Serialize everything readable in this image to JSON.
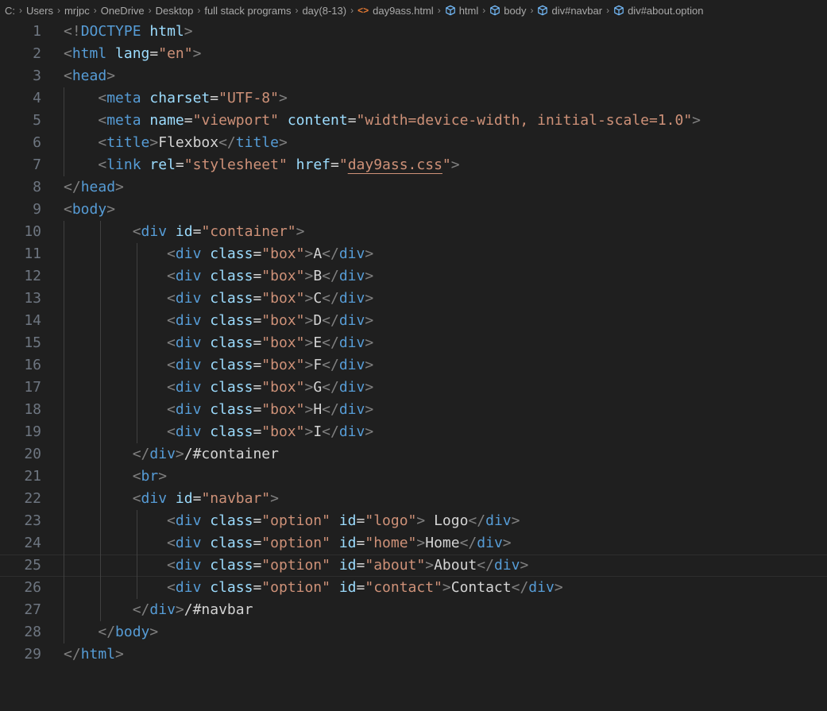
{
  "breadcrumbs": {
    "path": [
      "C:",
      "Users",
      "mrjpc",
      "OneDrive",
      "Desktop",
      "full stack programs",
      "day(8-13)"
    ],
    "file": "day9ass.html",
    "symbols": [
      "html",
      "body",
      "div#navbar",
      "div#about.option"
    ]
  },
  "editor": {
    "language": "html",
    "current_line": 25,
    "lines": [
      {
        "n": 1,
        "indent": 0,
        "tokens": [
          [
            "p",
            "<!"
          ],
          [
            "t",
            "DOCTYPE"
          ],
          [
            "x",
            " "
          ],
          [
            "a",
            "html"
          ],
          [
            "p",
            ">"
          ]
        ]
      },
      {
        "n": 2,
        "indent": 0,
        "tokens": [
          [
            "p",
            "<"
          ],
          [
            "t",
            "html"
          ],
          [
            "x",
            " "
          ],
          [
            "a",
            "lang"
          ],
          [
            "x",
            "="
          ],
          [
            "s",
            "\"en\""
          ],
          [
            "p",
            ">"
          ]
        ]
      },
      {
        "n": 3,
        "indent": 0,
        "tokens": [
          [
            "p",
            "<"
          ],
          [
            "t",
            "head"
          ],
          [
            "p",
            ">"
          ]
        ]
      },
      {
        "n": 4,
        "indent": 4,
        "tokens": [
          [
            "p",
            "<"
          ],
          [
            "t",
            "meta"
          ],
          [
            "x",
            " "
          ],
          [
            "a",
            "charset"
          ],
          [
            "x",
            "="
          ],
          [
            "s",
            "\"UTF-8\""
          ],
          [
            "p",
            ">"
          ]
        ]
      },
      {
        "n": 5,
        "indent": 4,
        "tokens": [
          [
            "p",
            "<"
          ],
          [
            "t",
            "meta"
          ],
          [
            "x",
            " "
          ],
          [
            "a",
            "name"
          ],
          [
            "x",
            "="
          ],
          [
            "s",
            "\"viewport\""
          ],
          [
            "x",
            " "
          ],
          [
            "a",
            "content"
          ],
          [
            "x",
            "="
          ],
          [
            "s",
            "\"width=device-width, initial-scale=1.0\""
          ],
          [
            "p",
            ">"
          ]
        ]
      },
      {
        "n": 6,
        "indent": 4,
        "tokens": [
          [
            "p",
            "<"
          ],
          [
            "t",
            "title"
          ],
          [
            "p",
            ">"
          ],
          [
            "x",
            "Flexbox"
          ],
          [
            "p",
            "</"
          ],
          [
            "t",
            "title"
          ],
          [
            "p",
            ">"
          ]
        ]
      },
      {
        "n": 7,
        "indent": 4,
        "tokens": [
          [
            "p",
            "<"
          ],
          [
            "t",
            "link"
          ],
          [
            "x",
            " "
          ],
          [
            "a",
            "rel"
          ],
          [
            "x",
            "="
          ],
          [
            "s",
            "\"stylesheet\""
          ],
          [
            "x",
            " "
          ],
          [
            "a",
            "href"
          ],
          [
            "x",
            "="
          ],
          [
            "s",
            "\""
          ],
          [
            "l",
            "day9ass.css"
          ],
          [
            "s",
            "\""
          ],
          [
            "p",
            ">"
          ]
        ]
      },
      {
        "n": 8,
        "indent": 0,
        "tokens": [
          [
            "p",
            "</"
          ],
          [
            "t",
            "head"
          ],
          [
            "p",
            ">"
          ]
        ]
      },
      {
        "n": 9,
        "indent": 0,
        "tokens": [
          [
            "p",
            "<"
          ],
          [
            "t",
            "body"
          ],
          [
            "p",
            ">"
          ]
        ]
      },
      {
        "n": 10,
        "indent": 8,
        "tokens": [
          [
            "p",
            "<"
          ],
          [
            "t",
            "div"
          ],
          [
            "x",
            " "
          ],
          [
            "a",
            "id"
          ],
          [
            "x",
            "="
          ],
          [
            "s",
            "\"container\""
          ],
          [
            "p",
            ">"
          ]
        ]
      },
      {
        "n": 11,
        "indent": 12,
        "tokens": [
          [
            "p",
            "<"
          ],
          [
            "t",
            "div"
          ],
          [
            "x",
            " "
          ],
          [
            "a",
            "class"
          ],
          [
            "x",
            "="
          ],
          [
            "s",
            "\"box\""
          ],
          [
            "p",
            ">"
          ],
          [
            "x",
            "A"
          ],
          [
            "p",
            "</"
          ],
          [
            "t",
            "div"
          ],
          [
            "p",
            ">"
          ]
        ]
      },
      {
        "n": 12,
        "indent": 12,
        "tokens": [
          [
            "p",
            "<"
          ],
          [
            "t",
            "div"
          ],
          [
            "x",
            " "
          ],
          [
            "a",
            "class"
          ],
          [
            "x",
            "="
          ],
          [
            "s",
            "\"box\""
          ],
          [
            "p",
            ">"
          ],
          [
            "x",
            "B"
          ],
          [
            "p",
            "</"
          ],
          [
            "t",
            "div"
          ],
          [
            "p",
            ">"
          ]
        ]
      },
      {
        "n": 13,
        "indent": 12,
        "tokens": [
          [
            "p",
            "<"
          ],
          [
            "t",
            "div"
          ],
          [
            "x",
            " "
          ],
          [
            "a",
            "class"
          ],
          [
            "x",
            "="
          ],
          [
            "s",
            "\"box\""
          ],
          [
            "p",
            ">"
          ],
          [
            "x",
            "C"
          ],
          [
            "p",
            "</"
          ],
          [
            "t",
            "div"
          ],
          [
            "p",
            ">"
          ]
        ]
      },
      {
        "n": 14,
        "indent": 12,
        "tokens": [
          [
            "p",
            "<"
          ],
          [
            "t",
            "div"
          ],
          [
            "x",
            " "
          ],
          [
            "a",
            "class"
          ],
          [
            "x",
            "="
          ],
          [
            "s",
            "\"box\""
          ],
          [
            "p",
            ">"
          ],
          [
            "x",
            "D"
          ],
          [
            "p",
            "</"
          ],
          [
            "t",
            "div"
          ],
          [
            "p",
            ">"
          ]
        ]
      },
      {
        "n": 15,
        "indent": 12,
        "tokens": [
          [
            "p",
            "<"
          ],
          [
            "t",
            "div"
          ],
          [
            "x",
            " "
          ],
          [
            "a",
            "class"
          ],
          [
            "x",
            "="
          ],
          [
            "s",
            "\"box\""
          ],
          [
            "p",
            ">"
          ],
          [
            "x",
            "E"
          ],
          [
            "p",
            "</"
          ],
          [
            "t",
            "div"
          ],
          [
            "p",
            ">"
          ]
        ]
      },
      {
        "n": 16,
        "indent": 12,
        "tokens": [
          [
            "p",
            "<"
          ],
          [
            "t",
            "div"
          ],
          [
            "x",
            " "
          ],
          [
            "a",
            "class"
          ],
          [
            "x",
            "="
          ],
          [
            "s",
            "\"box\""
          ],
          [
            "p",
            ">"
          ],
          [
            "x",
            "F"
          ],
          [
            "p",
            "</"
          ],
          [
            "t",
            "div"
          ],
          [
            "p",
            ">"
          ]
        ]
      },
      {
        "n": 17,
        "indent": 12,
        "tokens": [
          [
            "p",
            "<"
          ],
          [
            "t",
            "div"
          ],
          [
            "x",
            " "
          ],
          [
            "a",
            "class"
          ],
          [
            "x",
            "="
          ],
          [
            "s",
            "\"box\""
          ],
          [
            "p",
            ">"
          ],
          [
            "x",
            "G"
          ],
          [
            "p",
            "</"
          ],
          [
            "t",
            "div"
          ],
          [
            "p",
            ">"
          ]
        ]
      },
      {
        "n": 18,
        "indent": 12,
        "tokens": [
          [
            "p",
            "<"
          ],
          [
            "t",
            "div"
          ],
          [
            "x",
            " "
          ],
          [
            "a",
            "class"
          ],
          [
            "x",
            "="
          ],
          [
            "s",
            "\"box\""
          ],
          [
            "p",
            ">"
          ],
          [
            "x",
            "H"
          ],
          [
            "p",
            "</"
          ],
          [
            "t",
            "div"
          ],
          [
            "p",
            ">"
          ]
        ]
      },
      {
        "n": 19,
        "indent": 12,
        "tokens": [
          [
            "p",
            "<"
          ],
          [
            "t",
            "div"
          ],
          [
            "x",
            " "
          ],
          [
            "a",
            "class"
          ],
          [
            "x",
            "="
          ],
          [
            "s",
            "\"box\""
          ],
          [
            "p",
            ">"
          ],
          [
            "x",
            "I"
          ],
          [
            "p",
            "</"
          ],
          [
            "t",
            "div"
          ],
          [
            "p",
            ">"
          ]
        ]
      },
      {
        "n": 20,
        "indent": 8,
        "tokens": [
          [
            "p",
            "</"
          ],
          [
            "t",
            "div"
          ],
          [
            "p",
            ">"
          ],
          [
            "c",
            "/#container"
          ]
        ]
      },
      {
        "n": 21,
        "indent": 8,
        "tokens": [
          [
            "p",
            "<"
          ],
          [
            "t",
            "br"
          ],
          [
            "p",
            ">"
          ]
        ]
      },
      {
        "n": 22,
        "indent": 8,
        "tokens": [
          [
            "p",
            "<"
          ],
          [
            "t",
            "div"
          ],
          [
            "x",
            " "
          ],
          [
            "a",
            "id"
          ],
          [
            "x",
            "="
          ],
          [
            "s",
            "\"navbar\""
          ],
          [
            "p",
            ">"
          ]
        ]
      },
      {
        "n": 23,
        "indent": 12,
        "tokens": [
          [
            "p",
            "<"
          ],
          [
            "t",
            "div"
          ],
          [
            "x",
            " "
          ],
          [
            "a",
            "class"
          ],
          [
            "x",
            "="
          ],
          [
            "s",
            "\"option\""
          ],
          [
            "x",
            " "
          ],
          [
            "a",
            "id"
          ],
          [
            "x",
            "="
          ],
          [
            "s",
            "\"logo\""
          ],
          [
            "p",
            ">"
          ],
          [
            "x",
            " Logo"
          ],
          [
            "p",
            "</"
          ],
          [
            "t",
            "div"
          ],
          [
            "p",
            ">"
          ]
        ]
      },
      {
        "n": 24,
        "indent": 12,
        "tokens": [
          [
            "p",
            "<"
          ],
          [
            "t",
            "div"
          ],
          [
            "x",
            " "
          ],
          [
            "a",
            "class"
          ],
          [
            "x",
            "="
          ],
          [
            "s",
            "\"option\""
          ],
          [
            "x",
            " "
          ],
          [
            "a",
            "id"
          ],
          [
            "x",
            "="
          ],
          [
            "s",
            "\"home\""
          ],
          [
            "p",
            ">"
          ],
          [
            "x",
            "Home"
          ],
          [
            "p",
            "</"
          ],
          [
            "t",
            "div"
          ],
          [
            "p",
            ">"
          ]
        ]
      },
      {
        "n": 25,
        "indent": 12,
        "tokens": [
          [
            "p",
            "<"
          ],
          [
            "t",
            "div"
          ],
          [
            "x",
            " "
          ],
          [
            "a",
            "class"
          ],
          [
            "x",
            "="
          ],
          [
            "s",
            "\"option\""
          ],
          [
            "x",
            " "
          ],
          [
            "a",
            "id"
          ],
          [
            "x",
            "="
          ],
          [
            "s",
            "\"about\""
          ],
          [
            "p",
            ">"
          ],
          [
            "x",
            "About"
          ],
          [
            "p",
            "</"
          ],
          [
            "t",
            "div"
          ],
          [
            "p",
            ">"
          ]
        ]
      },
      {
        "n": 26,
        "indent": 12,
        "tokens": [
          [
            "p",
            "<"
          ],
          [
            "t",
            "div"
          ],
          [
            "x",
            " "
          ],
          [
            "a",
            "class"
          ],
          [
            "x",
            "="
          ],
          [
            "s",
            "\"option\""
          ],
          [
            "x",
            " "
          ],
          [
            "a",
            "id"
          ],
          [
            "x",
            "="
          ],
          [
            "s",
            "\"contact\""
          ],
          [
            "p",
            ">"
          ],
          [
            "x",
            "Contact"
          ],
          [
            "p",
            "</"
          ],
          [
            "t",
            "div"
          ],
          [
            "p",
            ">"
          ]
        ]
      },
      {
        "n": 27,
        "indent": 8,
        "tokens": [
          [
            "p",
            "</"
          ],
          [
            "t",
            "div"
          ],
          [
            "p",
            ">"
          ],
          [
            "c",
            "/#navbar"
          ]
        ]
      },
      {
        "n": 28,
        "indent": 4,
        "tokens": [
          [
            "p",
            "</"
          ],
          [
            "t",
            "body"
          ],
          [
            "p",
            ">"
          ]
        ]
      },
      {
        "n": 29,
        "indent": 0,
        "tokens": [
          [
            "p",
            "</"
          ],
          [
            "t",
            "html"
          ],
          [
            "p",
            ">"
          ]
        ]
      }
    ]
  },
  "colors": {
    "background": "#1f1f1f",
    "line_number": "#6e7681",
    "tag": "#569cd6",
    "attribute": "#9cdcfe",
    "string": "#ce9178",
    "punctuation": "#808080",
    "text": "#d4d4d4",
    "file_icon": "#e37933",
    "symbol_icon": "#75beff"
  }
}
